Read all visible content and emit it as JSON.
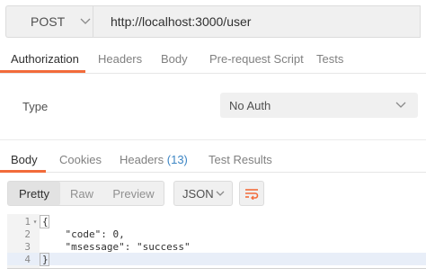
{
  "request": {
    "method": "POST",
    "url": "http://localhost:3000/user"
  },
  "request_tabs": [
    {
      "label": "Authorization",
      "active": true
    },
    {
      "label": "Headers",
      "active": false
    },
    {
      "label": "Body",
      "active": false
    },
    {
      "label": "Pre-request Script",
      "active": false
    },
    {
      "label": "Tests",
      "active": false
    }
  ],
  "auth": {
    "type_label": "Type",
    "selected": "No Auth"
  },
  "response_tabs": [
    {
      "label": "Body",
      "active": true
    },
    {
      "label": "Cookies",
      "active": false
    },
    {
      "label": "Headers",
      "count": "(13)",
      "active": false
    },
    {
      "label": "Test Results",
      "active": false
    }
  ],
  "view_modes": [
    {
      "label": "Pretty",
      "active": true
    },
    {
      "label": "Raw",
      "active": false
    },
    {
      "label": "Preview",
      "active": false
    }
  ],
  "format": {
    "selected": "JSON"
  },
  "response_body": {
    "lines": [
      {
        "num": "1",
        "fold": "▾",
        "text": "{"
      },
      {
        "num": "2",
        "fold": "",
        "text": "    \"code\": 0,"
      },
      {
        "num": "3",
        "fold": "",
        "text": "    \"msessage\": \"success\""
      },
      {
        "num": "4",
        "fold": "",
        "text": "}"
      }
    ]
  },
  "colors": {
    "accent": "#f26b3a",
    "link": "#3e86c4",
    "panel": "#f0f0f0"
  },
  "icons": {
    "method_dropdown": "chevron-down-icon",
    "auth_dropdown": "chevron-down-icon",
    "format_dropdown": "chevron-down-icon",
    "wrap": "wrap-lines-icon"
  }
}
